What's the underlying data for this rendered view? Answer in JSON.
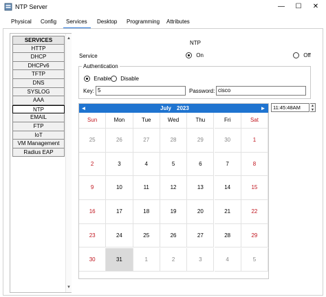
{
  "window": {
    "title": "NTP Server",
    "minimize": "—",
    "maximize": "☐",
    "close": "✕"
  },
  "tabs": [
    {
      "label": "Physical"
    },
    {
      "label": "Config"
    },
    {
      "label": "Services"
    },
    {
      "label": "Desktop"
    },
    {
      "label": "Programming"
    },
    {
      "label": "Attributes"
    }
  ],
  "active_tab": "Services",
  "services": {
    "header": "SERVICES",
    "items": [
      "HTTP",
      "DHCP",
      "DHCPv6",
      "TFTP",
      "DNS",
      "SYSLOG",
      "AAA",
      "NTP",
      "EMAIL",
      "FTP",
      "IoT",
      "VM Management",
      "Radius EAP"
    ],
    "selected": "NTP"
  },
  "ntp": {
    "title": "NTP",
    "service_label": "Service",
    "on_label": "On",
    "off_label": "Off",
    "service_on": true
  },
  "auth": {
    "title": "Authentication",
    "enable_label": "Enable",
    "disable_label": "Disable",
    "enabled": true,
    "key_label": "Key:",
    "key_value": "5",
    "password_label": "Password:",
    "password_value": "cisco"
  },
  "calendar": {
    "month": "July",
    "year": "2023",
    "prev_icon": "◄",
    "next_icon": "►",
    "weekdays": [
      "Sun",
      "Mon",
      "Tue",
      "Wed",
      "Thu",
      "Fri",
      "Sat"
    ],
    "weeks": [
      [
        "25",
        "26",
        "27",
        "28",
        "29",
        "30",
        "1"
      ],
      [
        "2",
        "3",
        "4",
        "5",
        "6",
        "7",
        "8"
      ],
      [
        "9",
        "10",
        "11",
        "12",
        "13",
        "14",
        "15"
      ],
      [
        "16",
        "17",
        "18",
        "19",
        "20",
        "21",
        "22"
      ],
      [
        "23",
        "24",
        "25",
        "26",
        "27",
        "28",
        "29"
      ],
      [
        "30",
        "31",
        "1",
        "2",
        "3",
        "4",
        "5"
      ]
    ],
    "selected_day": "31",
    "accent_color": "#1f74d0",
    "weekend_color": "#c0151e"
  },
  "time": {
    "value": "11:45:48AM"
  }
}
